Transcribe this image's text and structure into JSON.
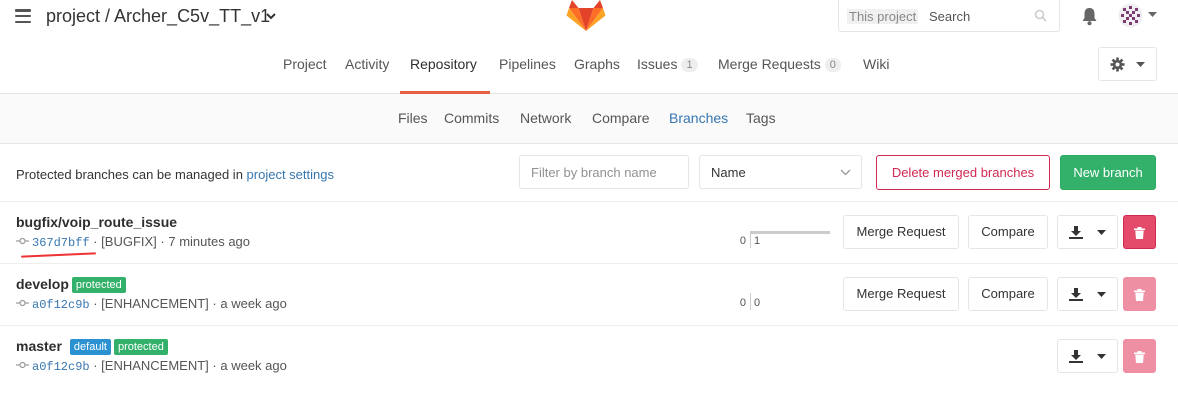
{
  "header": {
    "project_path": "project / Archer_C5v_TT_v1",
    "search_scope": "This project",
    "search_placeholder": "Search"
  },
  "main_nav": [
    {
      "label": "Project"
    },
    {
      "label": "Activity"
    },
    {
      "label": "Repository",
      "active": true
    },
    {
      "label": "Pipelines"
    },
    {
      "label": "Graphs"
    },
    {
      "label": "Issues",
      "count": "1"
    },
    {
      "label": "Merge Requests",
      "count": "0"
    },
    {
      "label": "Wiki"
    }
  ],
  "sub_nav": [
    {
      "label": "Files"
    },
    {
      "label": "Commits"
    },
    {
      "label": "Network"
    },
    {
      "label": "Compare"
    },
    {
      "label": "Branches",
      "active": true
    },
    {
      "label": "Tags"
    }
  ],
  "toolbar": {
    "info_text": "Protected branches can be managed in ",
    "info_link": "project settings",
    "filter_placeholder": "Filter by branch name",
    "sort_value": "Name",
    "delete_merged_label": "Delete merged branches",
    "new_branch_label": "New branch"
  },
  "branches": [
    {
      "name": "bugfix/voip_route_issue",
      "labels": [],
      "sha": "367d7bff",
      "message": "[BUGFIX]",
      "time": "7 minutes ago",
      "behind": "0",
      "ahead": "1",
      "merge_request_label": "Merge Request",
      "compare_label": "Compare"
    },
    {
      "name": "develop",
      "labels": [
        "protected"
      ],
      "sha": "a0f12c9b",
      "message": "[ENHANCEMENT]",
      "time": "a week ago",
      "behind": "0",
      "ahead": "0",
      "merge_request_label": "Merge Request",
      "compare_label": "Compare"
    },
    {
      "name": "master",
      "labels": [
        "default",
        "protected"
      ],
      "sha": "a0f12c9b",
      "message": "[ENHANCEMENT]",
      "time": "a week ago"
    }
  ],
  "separator": " · ",
  "colors": {
    "accent_link": "#3777b0",
    "protected_label": "#33b16b",
    "default_label": "#2b91d0",
    "danger": "#d22852",
    "success": "#33b16b",
    "active_tab_underline": "#e75e40"
  },
  "icons": [
    "hamburger-icon",
    "chevron-down-icon",
    "gitlab-logo",
    "search-icon",
    "bell-icon",
    "avatar",
    "gear-icon",
    "commit-icon",
    "download-icon",
    "trash-icon"
  ]
}
